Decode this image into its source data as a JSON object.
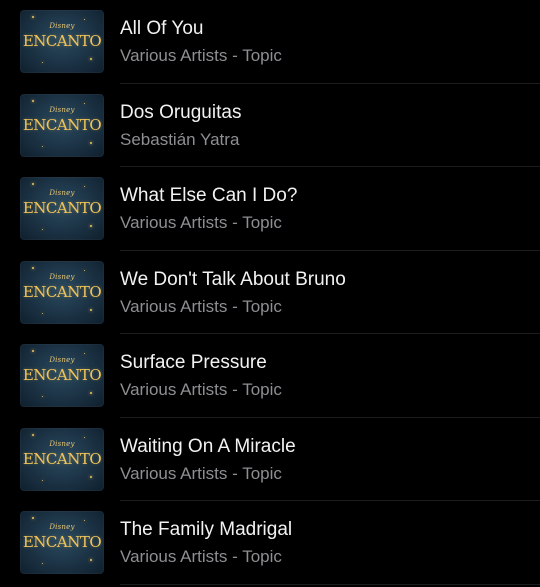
{
  "tracks": [
    {
      "title": "All Of You",
      "artist": "Various Artists - Topic",
      "artwork": {
        "brand": "Disney",
        "name": "ENCANTO"
      }
    },
    {
      "title": "Dos Oruguitas",
      "artist": "Sebastián Yatra",
      "artwork": {
        "brand": "Disney",
        "name": "ENCANTO"
      }
    },
    {
      "title": "What Else Can I Do?",
      "artist": "Various Artists - Topic",
      "artwork": {
        "brand": "Disney",
        "name": "ENCANTO"
      }
    },
    {
      "title": "We Don't Talk About Bruno",
      "artist": "Various Artists - Topic",
      "artwork": {
        "brand": "Disney",
        "name": "ENCANTO"
      }
    },
    {
      "title": "Surface Pressure",
      "artist": "Various Artists - Topic",
      "artwork": {
        "brand": "Disney",
        "name": "ENCANTO"
      }
    },
    {
      "title": "Waiting On A Miracle",
      "artist": "Various Artists - Topic",
      "artwork": {
        "brand": "Disney",
        "name": "ENCANTO"
      }
    },
    {
      "title": "The Family Madrigal",
      "artist": "Various Artists - Topic",
      "artwork": {
        "brand": "Disney",
        "name": "ENCANTO"
      }
    }
  ],
  "colors": {
    "background": "#000000",
    "title": "#f2f2f2",
    "subtitle": "#8e8e93",
    "divider": "#1c1c1e",
    "logo_gold": "#f0c45a"
  }
}
